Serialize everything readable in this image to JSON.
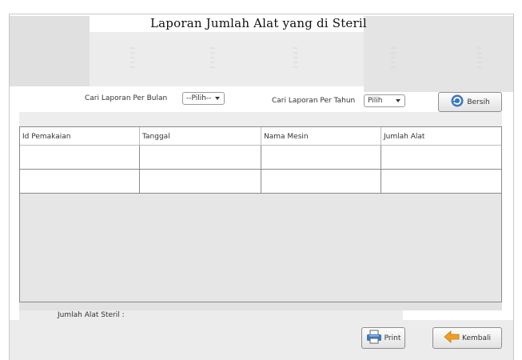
{
  "window": {
    "title": "Laporan Jumlah Alat yang di Steril"
  },
  "filters": {
    "bulan_label": "Cari Laporan Per Bulan",
    "bulan_value": "--Pilih--",
    "tahun_label": "Cari Laporan Per Tahun",
    "tahun_value": "Pilih",
    "bersih_label": "Bersih"
  },
  "table": {
    "columns": [
      "Id Pemakaian",
      "Tanggal",
      "Nama Mesin",
      "Jumlah Alat"
    ],
    "rows": [
      [
        "",
        "",
        "",
        ""
      ],
      [
        "",
        "",
        "",
        ""
      ]
    ]
  },
  "footer": {
    "total_label": "Jumlah Alat Steril :",
    "print_label": "Print",
    "kembali_label": "Kembali"
  },
  "colors": {
    "panel": "#e8e8e8",
    "border": "#8a8a8a",
    "accent_icon": "#3a78c2",
    "arrow_icon": "#f0a020"
  }
}
